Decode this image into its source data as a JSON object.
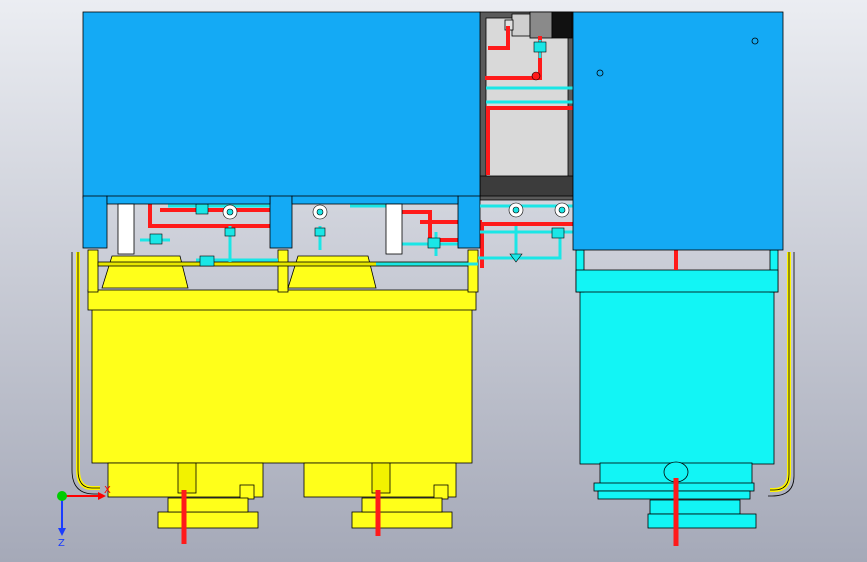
{
  "axes": {
    "x_label": "X",
    "z_label": "Z",
    "x_color": "#ff0000",
    "y_color": "#00cc00",
    "z_color": "#1a3cff"
  },
  "colors": {
    "background_top": "#ebedf2",
    "background_bottom": "#a5a9b8",
    "blue_panel": "#14aaf5",
    "yellow": "#ffff1a",
    "cyan": "#12f5f5",
    "red_pipe": "#ff1a1a",
    "cyan_pipe": "#1ae6e6",
    "frame_dark": "#3c3c3c",
    "outline": "#000000"
  },
  "icons": {
    "triad": "coordinate-triad-icon",
    "motor": "cylinder-motor-icon"
  }
}
